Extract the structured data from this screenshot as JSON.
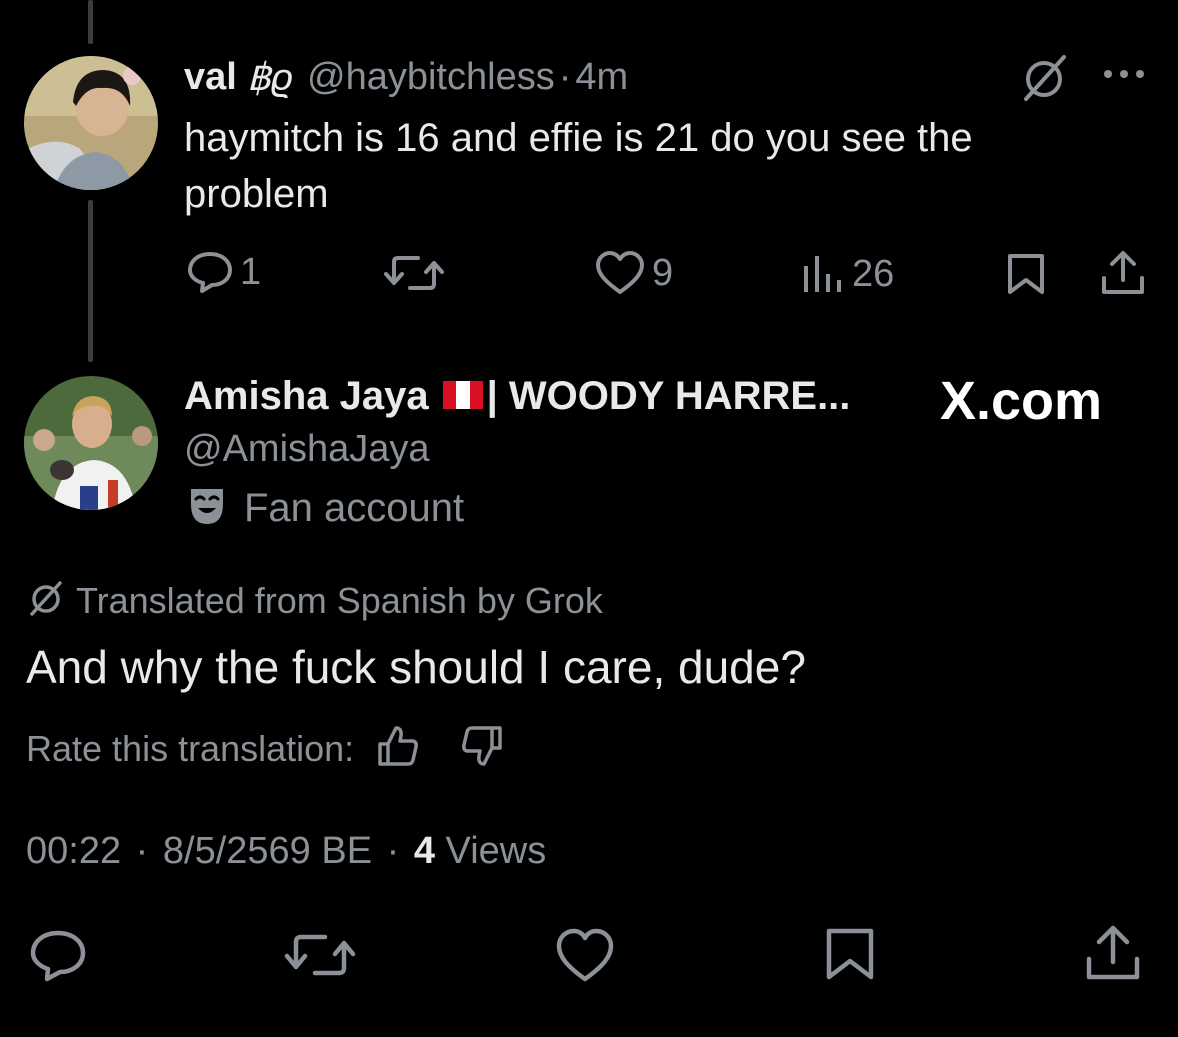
{
  "parent_post": {
    "display_name": "val",
    "name_emoji": "฿ϱ",
    "handle": "@haybitchless",
    "separator": "·",
    "time_ago": "4m",
    "text_line1": "haymitch is 16 and effie is 21 do you see the",
    "text_line2": "problem",
    "reply_count": "1",
    "like_count": "9",
    "view_count": "26"
  },
  "main_post": {
    "display_name": "Amisha Jaya",
    "name_suffix": "| WOODY HARRE...",
    "handle": "@AmishaJaya",
    "badge_label": "Fan account",
    "watermark": "X.com",
    "translation_note": "Translated from Spanish by Grok",
    "text": "And why the fuck should I care, dude?",
    "rate_label": "Rate this translation:",
    "timestamp": "00:22",
    "date": "8/5/2569 BE",
    "views_count": "4",
    "views_label": "Views",
    "sep1": "·",
    "sep2": "·"
  },
  "colors": {
    "background": "#000000",
    "primary_text": "#e7e9ea",
    "secondary_text": "#8b9196",
    "thread_line": "#3a3d40"
  },
  "icons": [
    "grok-icon",
    "more-icon",
    "reply-icon",
    "retweet-icon",
    "like-icon",
    "views-icon",
    "bookmark-icon",
    "share-icon",
    "flag-peru-icon",
    "fan-mask-icon",
    "thumbs-up-icon",
    "thumbs-down-icon"
  ]
}
